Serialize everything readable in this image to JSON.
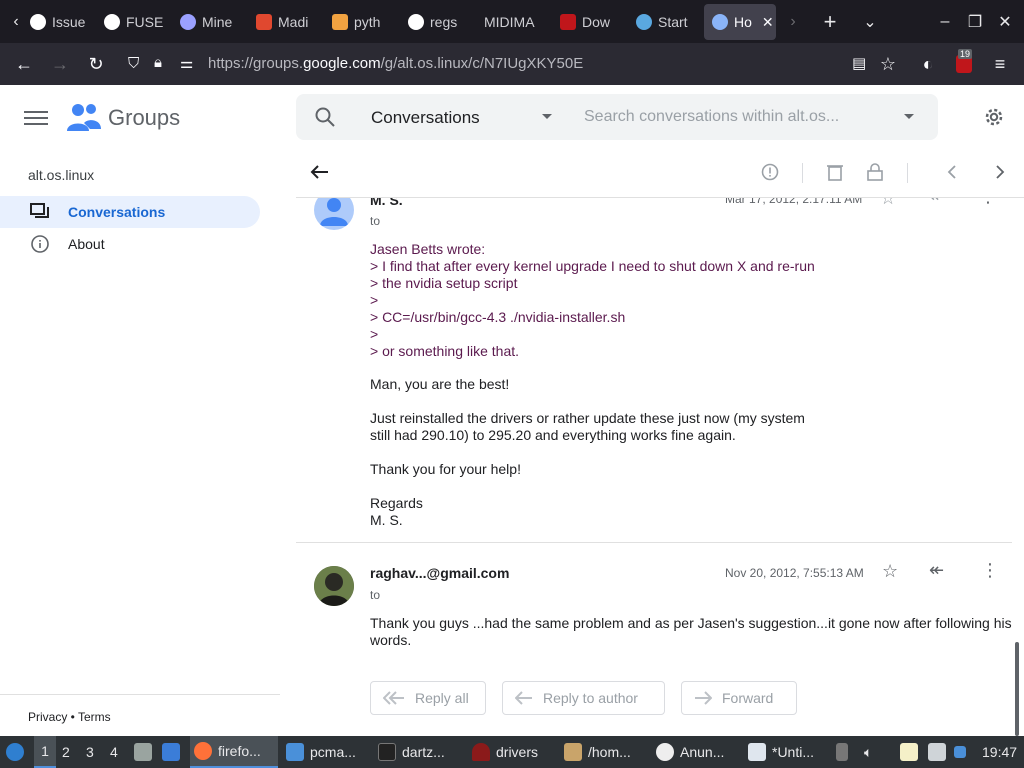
{
  "browser": {
    "tabs": [
      {
        "label": "Issue",
        "icon": "github-icon"
      },
      {
        "label": "FUSE",
        "icon": "github-icon"
      },
      {
        "label": "Mine",
        "icon": "star-icon"
      },
      {
        "label": "Madi",
        "icon": "bookmark-icon"
      },
      {
        "label": "pyth",
        "icon": "python-icon"
      },
      {
        "label": "regs",
        "icon": "google-icon"
      },
      {
        "label": "MIDIMA",
        "icon": "none"
      },
      {
        "label": "Dow",
        "icon": "w-icon"
      },
      {
        "label": "Start",
        "icon": "c-icon"
      },
      {
        "label": "Ho",
        "icon": "groups-icon"
      }
    ],
    "url_prefix": "https://groups.",
    "url_domain": "google.com",
    "url_path": "/g/alt.os.linux/c/N7IUgXKY50E",
    "badge_count": "19"
  },
  "groups": {
    "logo_text": "Groups",
    "group_name": "alt.os.linux",
    "nav": [
      {
        "label": "Conversations"
      },
      {
        "label": "About"
      }
    ],
    "footer": "Privacy • Terms",
    "search_scope": "Conversations",
    "search_placeholder": "Search conversations within alt.os..."
  },
  "thread": {
    "messages": [
      {
        "sender": "M. S.",
        "to": "to",
        "date": "Mar 17, 2012, 2:17:11 AM",
        "quote_lines": [
          "Jasen Betts wrote:",
          "> I find that after every kernel upgrade I need to shut down X and re-run",
          "> the nvidia setup script",
          ">",
          "> CC=/usr/bin/gcc-4.3 ./nvidia-installer.sh",
          ">",
          "> or something like that."
        ],
        "body": "Man, you are the best!\n\nJust reinstalled the drivers or rather update these just now (my system\nstill had 290.10) to 295.20 and everything works fine again.\n\nThank you for your help!\n\nRegards\nM. S."
      },
      {
        "sender": "raghav...@gmail.com",
        "to": "to",
        "date": "Nov 20, 2012, 7:55:13 AM",
        "body": "Thank you guys ...had the same problem and as per Jasen's suggestion...it gone now after following his\nwords."
      }
    ],
    "actions": {
      "reply_all": "Reply all",
      "reply_author": "Reply to author",
      "forward": "Forward"
    }
  },
  "taskbar": {
    "workspaces": [
      "1",
      "2",
      "3",
      "4"
    ],
    "apps": [
      {
        "label": "firefo..."
      },
      {
        "label": "pcma..."
      },
      {
        "label": "dartz..."
      },
      {
        "label": "drivers"
      },
      {
        "label": "/hom..."
      },
      {
        "label": "Anun..."
      },
      {
        "label": "*Unti..."
      }
    ],
    "clock": "19:47"
  },
  "colors": {
    "accent": "#1967d2",
    "quote": "#5b1a4e",
    "browser_dark": "#1c1b22"
  }
}
